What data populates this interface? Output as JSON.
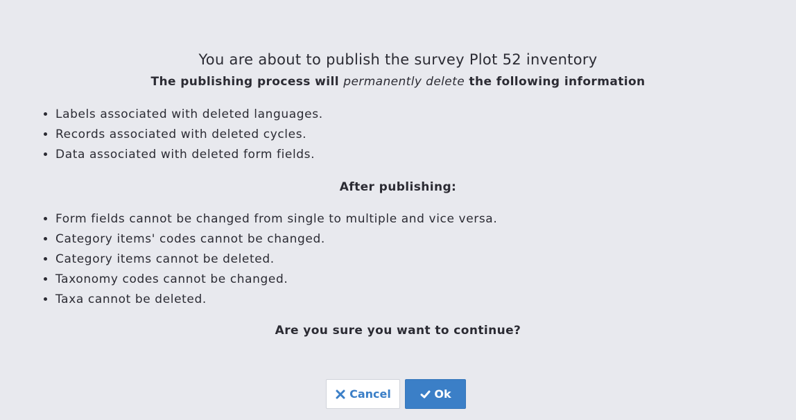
{
  "dialog": {
    "title": "You are about to publish the survey Plot 52 inventory",
    "subtitle_before": "The publishing process will ",
    "subtitle_emphasis": "permanently delete",
    "subtitle_after": " the following information",
    "delete_items": [
      "Labels associated with deleted languages.",
      "Records associated with deleted cycles.",
      "Data associated with deleted form fields."
    ],
    "after_heading": "After publishing:",
    "after_items": [
      "Form fields cannot be changed from single to multiple and vice versa.",
      "Category items' codes cannot be changed.",
      "Category items cannot be deleted.",
      "Taxonomy codes cannot be changed.",
      "Taxa cannot be deleted."
    ],
    "question": "Are you sure you want to continue?"
  },
  "buttons": {
    "cancel_label": "Cancel",
    "cancel_icon": "close-icon",
    "ok_label": "Ok",
    "ok_icon": "check-icon"
  },
  "colors": {
    "background": "#e8e9ee",
    "primary": "#3b7fc7",
    "text": "#2b2b33"
  }
}
